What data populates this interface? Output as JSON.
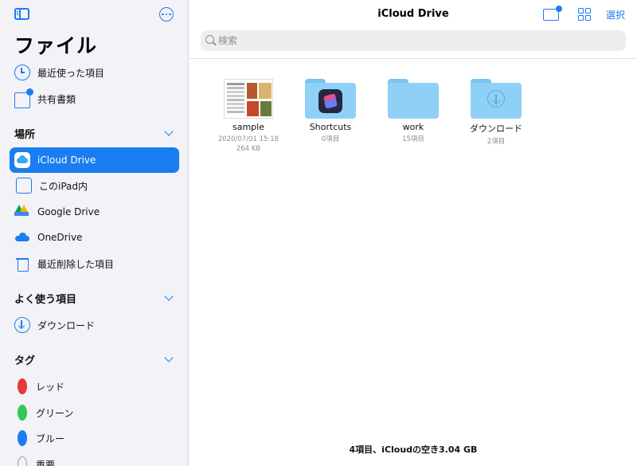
{
  "sidebar": {
    "title": "ファイル",
    "top_items": [
      {
        "label": "最近使った項目",
        "icon": "clock-icon"
      },
      {
        "label": "共有書類",
        "icon": "shared-folder-icon"
      }
    ],
    "locations": {
      "title": "場所",
      "items": [
        {
          "label": "iCloud Drive",
          "icon": "icloud-icon",
          "selected": true
        },
        {
          "label": "このiPad内",
          "icon": "ipad-icon"
        },
        {
          "label": "Google Drive",
          "icon": "google-drive-icon"
        },
        {
          "label": "OneDrive",
          "icon": "onedrive-icon"
        },
        {
          "label": "最近削除した項目",
          "icon": "trash-icon"
        }
      ]
    },
    "favorites": {
      "title": "よく使う項目",
      "items": [
        {
          "label": "ダウンロード",
          "icon": "download-icon"
        }
      ]
    },
    "tags": {
      "title": "タグ",
      "items": [
        {
          "label": "レッド",
          "color": "#e53935"
        },
        {
          "label": "グリーン",
          "color": "#34c759"
        },
        {
          "label": "ブルー",
          "color": "#1a7df2"
        },
        {
          "label": "重要",
          "color": "none"
        }
      ]
    }
  },
  "main": {
    "title": "iCloud Drive",
    "select_label": "選択",
    "search": {
      "placeholder": "検索",
      "value": ""
    },
    "items": [
      {
        "name": "sample",
        "meta1": "2020/07/01 15:18",
        "meta2": "264 KB",
        "type": "document"
      },
      {
        "name": "Shortcuts",
        "meta1": "0項目",
        "type": "folder"
      },
      {
        "name": "work",
        "meta1": "15項目",
        "type": "folder"
      },
      {
        "name": "ダウンロード",
        "meta1": "2項目",
        "type": "folder"
      }
    ],
    "footer": "4項目、iCloudの空き3.04 GB"
  },
  "colors": {
    "accent": "#1a7df2",
    "folder": "#8fd0f7",
    "sidebar_bg": "#f2f2f7"
  }
}
